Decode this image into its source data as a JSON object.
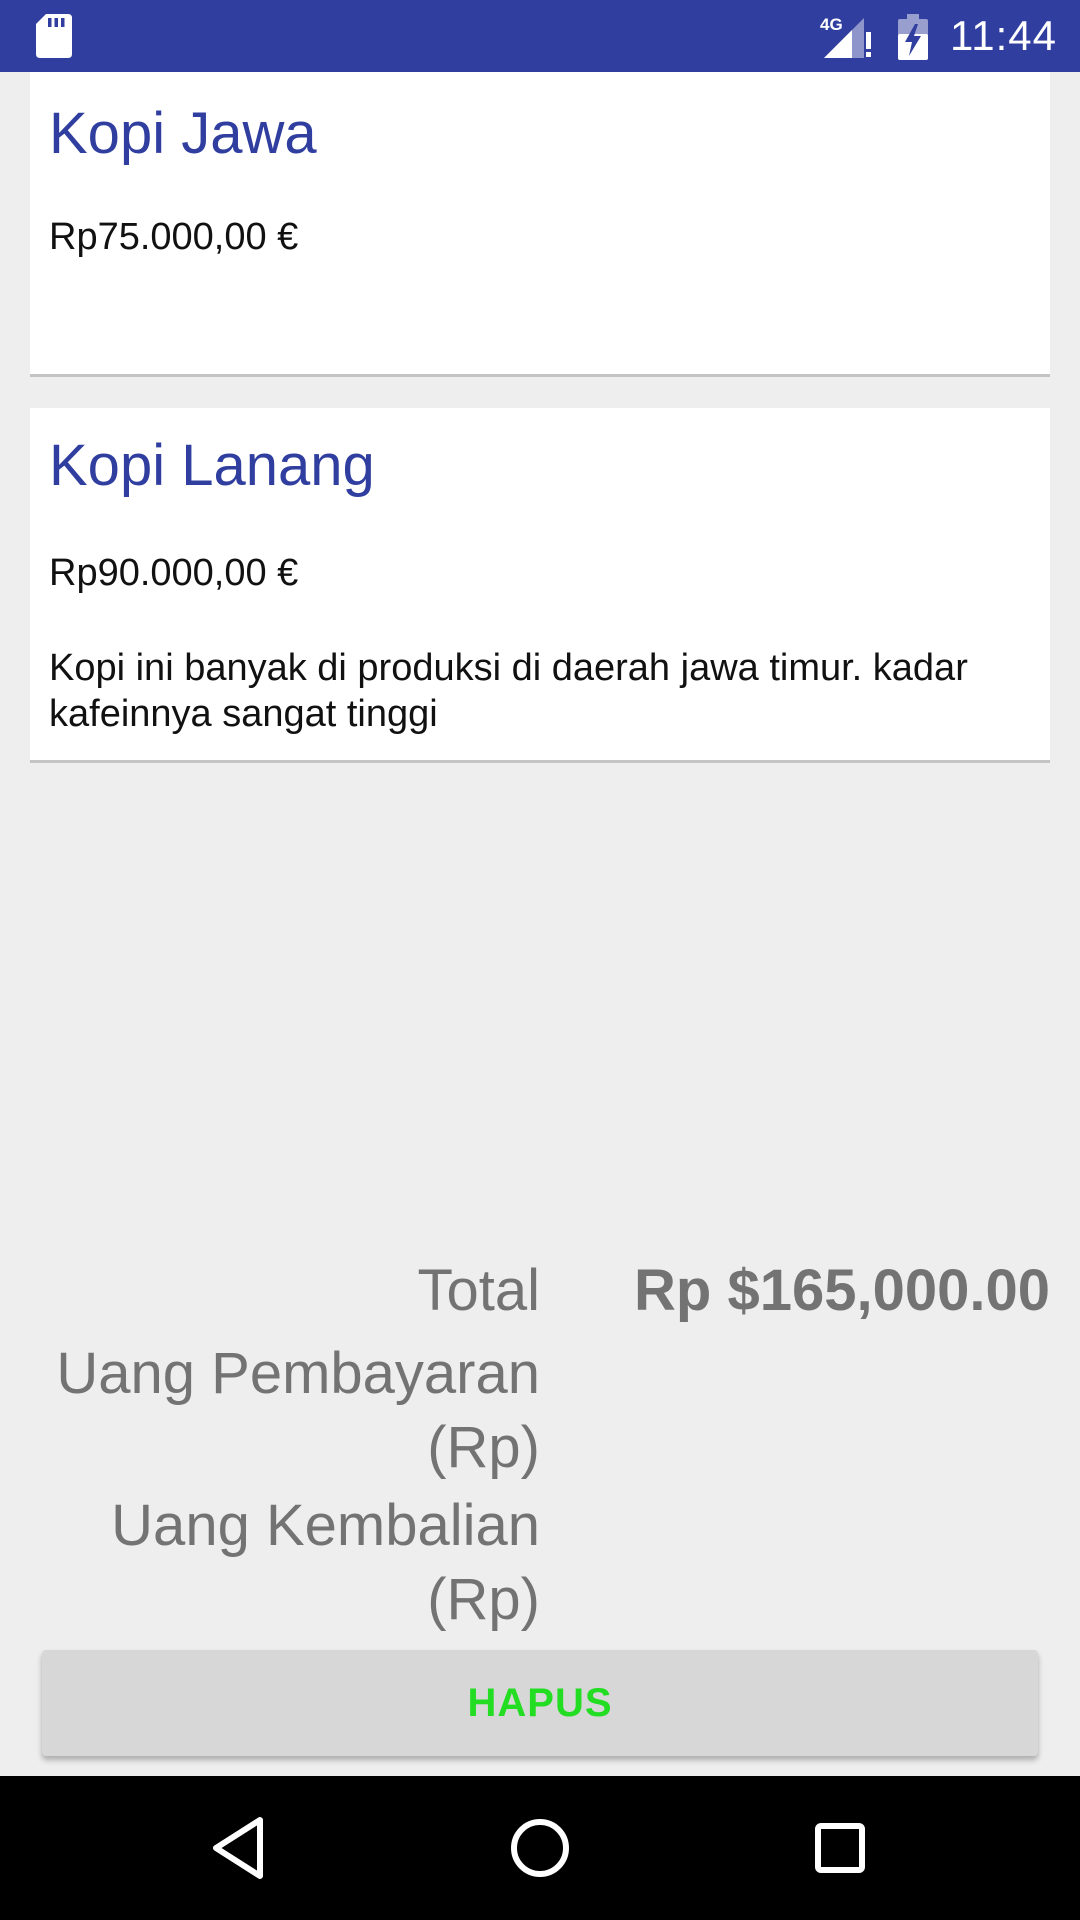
{
  "status_bar": {
    "time": "11:44",
    "network_label": "4G",
    "icons": [
      "sd-card-icon",
      "cellular-signal-icon",
      "battery-charging-icon"
    ],
    "background_color": "#303f9f"
  },
  "items": [
    {
      "name": "Kopi Jawa",
      "price": "Rp75.000,00 €",
      "description": ""
    },
    {
      "name": "Kopi Lanang",
      "price": "Rp90.000,00 €",
      "description": "Kopi ini banyak di produksi di daerah jawa timur. kadar kafeinnya sangat tinggi"
    }
  ],
  "summary": {
    "total_label": "Total",
    "total_value": "Rp $165,000.00",
    "payment_label": "Uang Pembayaran (Rp)",
    "change_label": "Uang Kembalian (Rp)"
  },
  "actions": {
    "delete_label": "HAPUS",
    "delete_color": "#22dd22"
  },
  "nav_bar": {
    "icons": [
      "back-icon",
      "home-icon",
      "recents-icon"
    ]
  }
}
